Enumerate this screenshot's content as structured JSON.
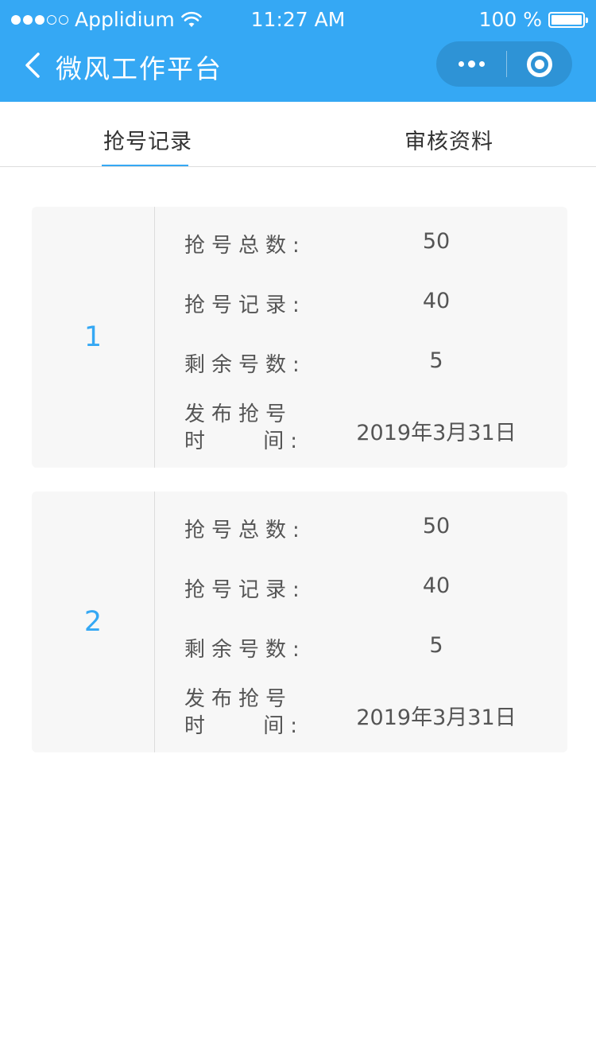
{
  "status_bar": {
    "carrier": "Applidium",
    "time": "11:27 AM",
    "battery": "100 %",
    "icons": [
      "signal-dots-icon",
      "wifi-icon",
      "battery-icon"
    ]
  },
  "nav": {
    "title": "微风工作平台",
    "back_icon": "chevron-left-icon",
    "more_icon": "more-dots-icon",
    "close_icon": "target-circle-icon"
  },
  "tabs": [
    {
      "label": "抢号记录",
      "active": true
    },
    {
      "label": "审核资料",
      "active": false
    }
  ],
  "colors": {
    "accent": "#35a8f4",
    "card_bg": "#f7f7f7",
    "text": "#555555"
  },
  "cards": [
    {
      "index": "1",
      "rows": [
        {
          "label": "抢号总数:",
          "value": "50"
        },
        {
          "label": "抢号记录:",
          "value": "40"
        },
        {
          "label": "剩余号数:",
          "value": "5"
        }
      ],
      "publish": {
        "label_line1": "发布抢号",
        "label_line2_a": "时",
        "label_line2_b": "间:",
        "value": "2019年3月31日"
      }
    },
    {
      "index": "2",
      "rows": [
        {
          "label": "抢号总数:",
          "value": "50"
        },
        {
          "label": "抢号记录:",
          "value": "40"
        },
        {
          "label": "剩余号数:",
          "value": "5"
        }
      ],
      "publish": {
        "label_line1": "发布抢号",
        "label_line2_a": "时",
        "label_line2_b": "间:",
        "value": "2019年3月31日"
      }
    }
  ]
}
